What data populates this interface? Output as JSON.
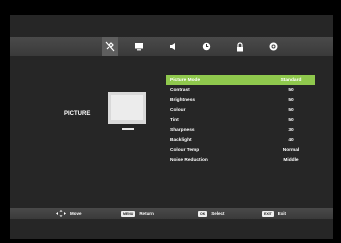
{
  "topbar": {
    "icons": [
      {
        "name": "picture-settings-icon",
        "active": true
      },
      {
        "name": "screen-icon",
        "active": false
      },
      {
        "name": "sound-icon",
        "active": false
      },
      {
        "name": "clock-icon",
        "active": false
      },
      {
        "name": "lock-icon",
        "active": false
      },
      {
        "name": "settings-gear-icon",
        "active": false
      }
    ]
  },
  "category": "PICTURE",
  "menu": {
    "items": [
      {
        "label": "Picture Mode",
        "value": "Standard"
      },
      {
        "label": "Contrast",
        "value": "50"
      },
      {
        "label": "Brightness",
        "value": "50"
      },
      {
        "label": "Colour",
        "value": "50"
      },
      {
        "label": "Tint",
        "value": "50"
      },
      {
        "label": "Sharpness",
        "value": "30"
      },
      {
        "label": "Backlight",
        "value": "40"
      },
      {
        "label": "Colour Temp",
        "value": "Normal"
      },
      {
        "label": "Noise Reduction",
        "value": "Middle"
      }
    ]
  },
  "hints": {
    "move": "Move",
    "menu_key": "MENU",
    "return": "Return",
    "ok_key": "OK",
    "select": "Select",
    "exit_key": "EXIT",
    "exit": "Exit"
  }
}
